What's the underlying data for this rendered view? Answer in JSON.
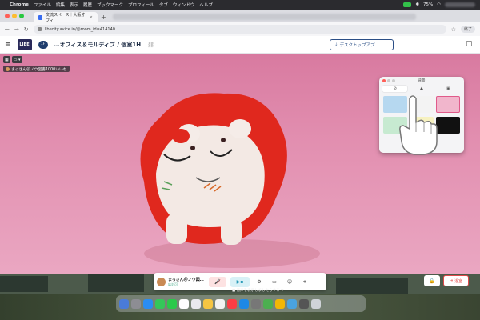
{
  "menubar": {
    "app_name": "Chrome",
    "menus": [
      "ファイル",
      "編集",
      "表示",
      "履歴",
      "ブックマーク",
      "プロフィール",
      "タブ",
      "ウィンドウ",
      "ヘルプ"
    ],
    "battery": "75%"
  },
  "browser": {
    "tab_title": "交流スペース｜大阪オフィ",
    "tab_close": "×",
    "new_tab": "+",
    "url": "libecity.avice.in/@room_id=414140",
    "profile_label": "終了"
  },
  "header": {
    "logo_text": "LIBE",
    "floor_badge": "1F",
    "room_title": "…オフィス＆モルディブ / 個室1H",
    "download_button": "デスクトップアプ"
  },
  "stage": {
    "participant_name": "まっさん＠ノウ図書1000いいね",
    "settings_popup": {
      "title": "背景",
      "swatch_colors": [
        "#b6d8f0",
        "#f3f3f3",
        "#f1b6cc",
        "#c7ead1",
        "#f6f1c0",
        "#111111"
      ]
    }
  },
  "controls": {
    "user_name": "まっさん＠ノウ図…",
    "user_status": "応対可"
  },
  "toast": "■ 音声を表示しましたらする ▼",
  "leave_button": "退室",
  "colors": {
    "stage_pink": "#e28fb0",
    "accent_blue": "#2b4f86",
    "leave_red": "#e04848"
  }
}
